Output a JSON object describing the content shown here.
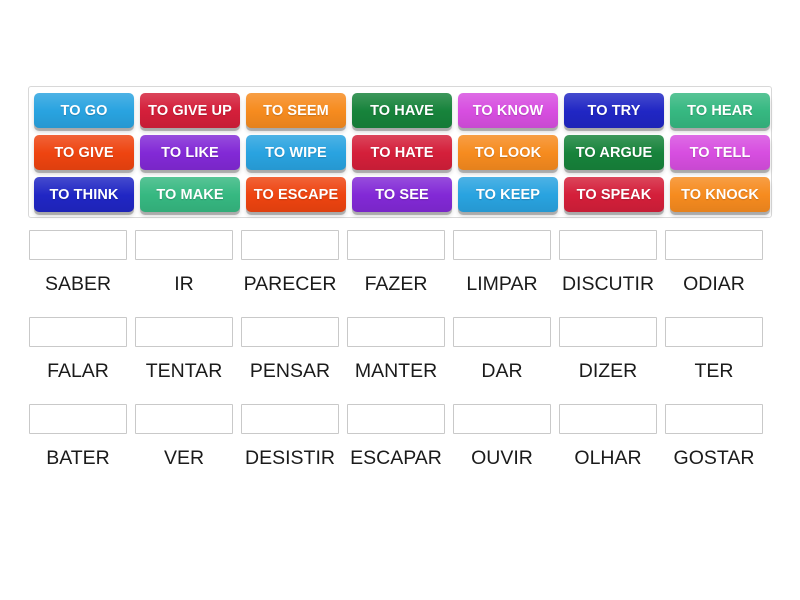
{
  "activity": {
    "type": "match-up-word-tiles",
    "tile_text_color": "#ffffff",
    "box_border_color": "#c9c9c9",
    "word_text_color": "#1b1b1b"
  },
  "tile_bank": {
    "rows": [
      [
        {
          "label": "TO GO",
          "color": "#29a3e0"
        },
        {
          "label": "TO GIVE UP",
          "color": "#d41f3a"
        },
        {
          "label": "TO SEEM",
          "color": "#f68b1f"
        },
        {
          "label": "TO HAVE",
          "color": "#17833b"
        },
        {
          "label": "TO KNOW",
          "color": "#d74ee0"
        },
        {
          "label": "TO TRY",
          "color": "#2026c4"
        },
        {
          "label": "TO HEAR",
          "color": "#36b881"
        }
      ],
      [
        {
          "label": "TO GIVE",
          "color": "#ee4410"
        },
        {
          "label": "TO LIKE",
          "color": "#8229d6"
        },
        {
          "label": "TO WIPE",
          "color": "#29a3e0"
        },
        {
          "label": "TO HATE",
          "color": "#d41f3a"
        },
        {
          "label": "TO LOOK",
          "color": "#f68b1f"
        },
        {
          "label": "TO ARGUE",
          "color": "#17833b"
        },
        {
          "label": "TO TELL",
          "color": "#d74ee0"
        }
      ],
      [
        {
          "label": "TO THINK",
          "color": "#2026c4"
        },
        {
          "label": "TO MAKE",
          "color": "#36b881"
        },
        {
          "label": "TO ESCAPE",
          "color": "#ee4410"
        },
        {
          "label": "TO SEE",
          "color": "#8229d6"
        },
        {
          "label": "TO KEEP",
          "color": "#29a3e0"
        },
        {
          "label": "TO SPEAK",
          "color": "#d41f3a"
        },
        {
          "label": "TO KNOCK",
          "color": "#f68b1f"
        }
      ]
    ]
  },
  "answer_area": {
    "rows": [
      [
        {
          "word": "SABER",
          "value": ""
        },
        {
          "word": "IR",
          "value": ""
        },
        {
          "word": "PARECER",
          "value": ""
        },
        {
          "word": "FAZER",
          "value": ""
        },
        {
          "word": "LIMPAR",
          "value": ""
        },
        {
          "word": "DISCUTIR",
          "value": ""
        },
        {
          "word": "ODIAR",
          "value": ""
        }
      ],
      [
        {
          "word": "FALAR",
          "value": ""
        },
        {
          "word": "TENTAR",
          "value": ""
        },
        {
          "word": "PENSAR",
          "value": ""
        },
        {
          "word": "MANTER",
          "value": ""
        },
        {
          "word": "DAR",
          "value": ""
        },
        {
          "word": "DIZER",
          "value": ""
        },
        {
          "word": "TER",
          "value": ""
        }
      ],
      [
        {
          "word": "BATER",
          "value": ""
        },
        {
          "word": "VER",
          "value": ""
        },
        {
          "word": "DESISTIR",
          "value": ""
        },
        {
          "word": "ESCAPAR",
          "value": ""
        },
        {
          "word": "OUVIR",
          "value": ""
        },
        {
          "word": "OLHAR",
          "value": ""
        },
        {
          "word": "GOSTAR",
          "value": ""
        }
      ]
    ]
  }
}
